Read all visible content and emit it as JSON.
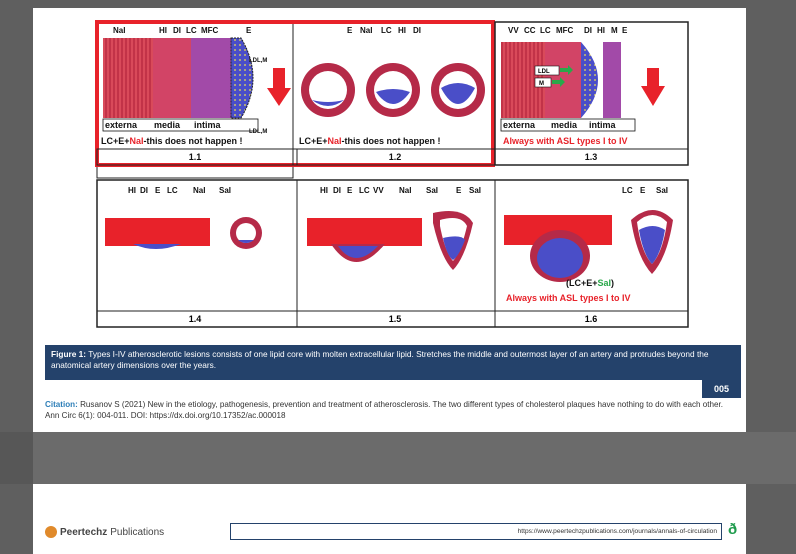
{
  "figure": {
    "panel1_1": {
      "labels": [
        "NaI",
        "HI",
        "DI",
        "LC",
        "MFC",
        "E"
      ],
      "ldl_top": "LDL,M",
      "ldl_bottom": "LDL,M",
      "layers": [
        "externa",
        "media",
        "intima"
      ],
      "statement_lead": "LC+E+",
      "statement_red": "NaI",
      "statement_tail": "-this does not happen !",
      "num": "1.1"
    },
    "panel1_2": {
      "labels": [
        "E",
        "NaI",
        "LC",
        "HI",
        "DI"
      ],
      "statement_lead": "LC+E+",
      "statement_red": "NaI",
      "statement_tail": "-this does not happen !",
      "num": "1.2"
    },
    "panel1_3": {
      "labels": [
        "VV",
        "CC",
        "LC",
        "MFC",
        "DI",
        "HI",
        "M",
        "E"
      ],
      "tag_ldl": "LDL",
      "tag_m": "M",
      "layers": [
        "externa",
        "media",
        "intima"
      ],
      "statement": "Always with ASL types",
      "roman": "I to IV",
      "num": "1.3"
    },
    "panel1_4": {
      "labels": [
        "HI",
        "DI",
        "E",
        "LC",
        "NaI",
        "SaI"
      ],
      "num": "1.4"
    },
    "panel1_5": {
      "labels": [
        "HI",
        "DI",
        "E",
        "LC",
        "VV",
        "NaI",
        "SaI",
        "E",
        "SaI"
      ],
      "num": "1.5"
    },
    "panel1_6": {
      "labels": [
        "LC",
        "E",
        "SaI"
      ],
      "formula_lead": "(LC+E+",
      "formula_green": "SaI",
      "formula_tail": ")",
      "statement": "Always with ASL types",
      "roman": "I to IV",
      "num": "1.6"
    }
  },
  "caption": {
    "label": "Figure 1:",
    "text": "Types I-IV atherosclerotic lesions consists of one lipid core with molten extracellular lipid. Stretches the middle and outermost layer of an artery and protrudes beyond the anatomical artery dimensions over the years."
  },
  "page_number": "005",
  "citation": {
    "label": "Citation:",
    "text": "Rusanov S (2021) New in the etiology, pathogenesis, prevention and treatment of atherosclerosis. The two different types of cholesterol plaques have nothing to do with each other. Ann Circ 6(1): 004-011. DOI: https://dx.doi.org/10.17352/ac.000018"
  },
  "footer": {
    "brand": "Peertechz",
    "brand_suffix": "Publications",
    "url": "https://www.peertechzpublications.com/journals/annals-of-circulation",
    "open_access_icon": "open-access-icon"
  },
  "colors": {
    "red": "#e8222a",
    "media": "#c9405a",
    "intima": "#9b3f9e",
    "lipid": "#4a4ec8",
    "navy": "#24426b",
    "green": "#2aa84a"
  }
}
